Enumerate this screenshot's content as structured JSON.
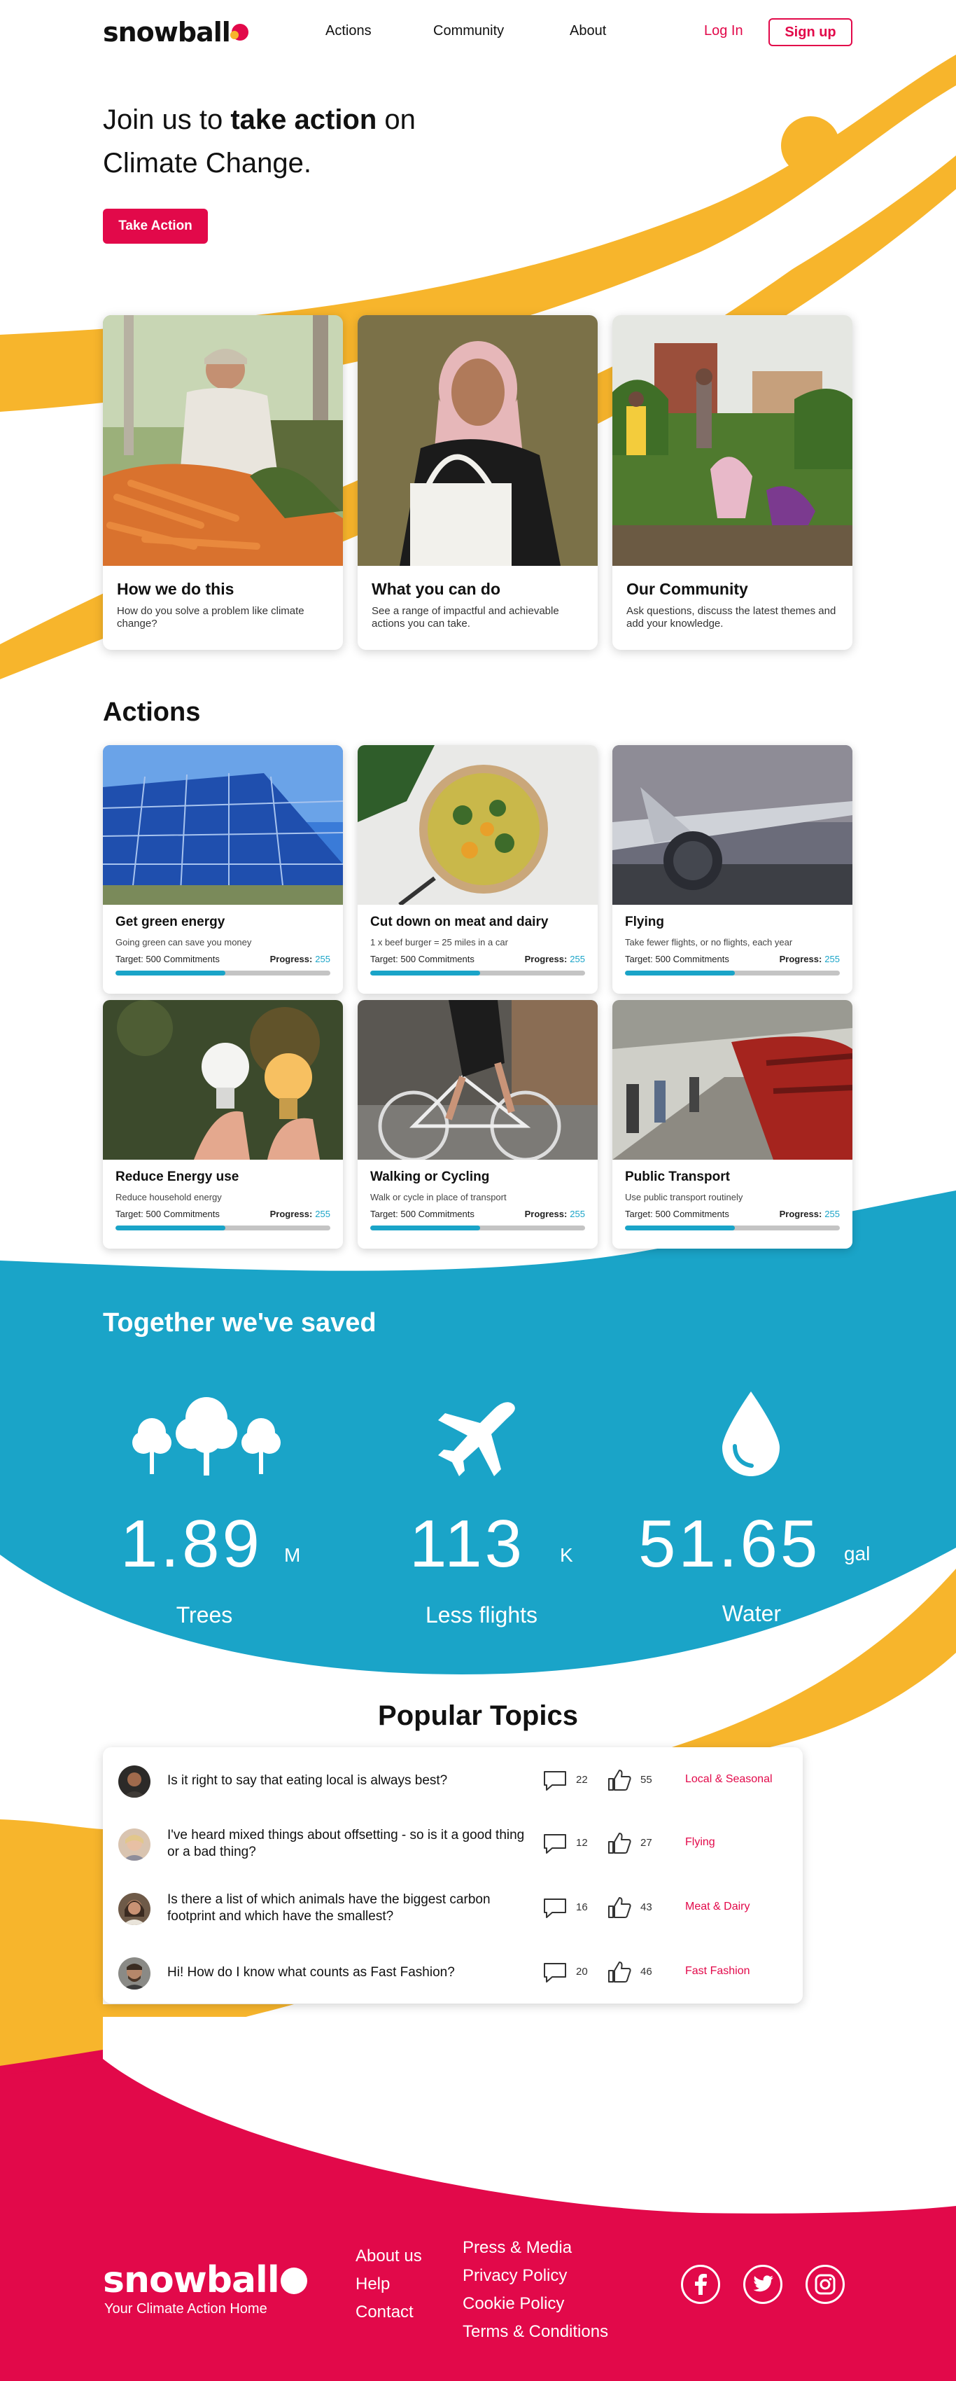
{
  "brand": {
    "name": "snowball",
    "tagline": "Your Climate Action Home",
    "primary_color": "#e2094a",
    "accent_yellow": "#f7b52c",
    "accent_blue": "#1aa4c8"
  },
  "header": {
    "nav": [
      "Actions",
      "Community",
      "About"
    ],
    "login_label": "Log In",
    "signup_label": "Sign up"
  },
  "hero": {
    "title_prefix": "Join us to ",
    "title_bold": "take action",
    "title_suffix": " on",
    "title_line2": "Climate Change.",
    "cta_label": "Take Action"
  },
  "features": [
    {
      "title": "How we do this",
      "description": "How do you solve a problem like climate change?",
      "image": "farmer-carrots-photo"
    },
    {
      "title": "What you can do",
      "description": "See a range of impactful and achievable actions you can take.",
      "image": "woman-tote-bag-photo"
    },
    {
      "title": "Our Community",
      "description": "Ask questions, discuss the latest themes and add your knowledge.",
      "image": "community-garden-photo"
    }
  ],
  "actions": {
    "heading": "Actions",
    "target_label": "Target:",
    "progress_label": "Progress:",
    "items": [
      {
        "title": "Get green energy",
        "description": "Going green can save you money",
        "target": "500 Commitments",
        "progress": "255",
        "progress_fraction": 0.51,
        "image": "solar-panels-photo"
      },
      {
        "title": "Cut down on meat and dairy",
        "description": "1 x beef burger = 25 miles in a car",
        "target": "500 Commitments",
        "progress": "255",
        "progress_fraction": 0.51,
        "image": "salad-bowl-photo"
      },
      {
        "title": "Flying",
        "description": "Take fewer flights, or no flights, each year",
        "target": "500 Commitments",
        "progress": "255",
        "progress_fraction": 0.51,
        "image": "airplane-photo"
      },
      {
        "title": "Reduce Energy use",
        "description": "Reduce household energy",
        "target": "500 Commitments",
        "progress": "255",
        "progress_fraction": 0.51,
        "image": "light-bulbs-photo"
      },
      {
        "title": "Walking or Cycling",
        "description": "Walk or cycle in place of transport",
        "target": "500 Commitments",
        "progress": "255",
        "progress_fraction": 0.51,
        "image": "cyclist-photo"
      },
      {
        "title": "Public Transport",
        "description": "Use public transport routinely",
        "target": "500 Commitments",
        "progress": "255",
        "progress_fraction": 0.51,
        "image": "train-station-photo"
      }
    ]
  },
  "saved": {
    "heading": "Together we've saved",
    "stats": [
      {
        "icon": "trees-icon",
        "value": "1.89",
        "unit": "M",
        "label": "Trees"
      },
      {
        "icon": "airplane-icon",
        "value": "113",
        "unit": "K",
        "label": "Less flights"
      },
      {
        "icon": "water-drop-icon",
        "value": "51.65",
        "unit": "gal",
        "label": "Water"
      }
    ]
  },
  "topics": {
    "heading": "Popular Topics",
    "items": [
      {
        "question": "Is it right to say that eating local is always best?",
        "comments": "22",
        "likes": "55",
        "tag": "Local & Seasonal"
      },
      {
        "question": "I've heard mixed things about offsetting - so is it a good thing or a bad thing?",
        "comments": "12",
        "likes": "27",
        "tag": "Flying"
      },
      {
        "question": "Is there a list of which animals have the biggest carbon footprint and which have the smallest?",
        "comments": "16",
        "likes": "43",
        "tag": "Meat & Dairy"
      },
      {
        "question": "Hi! How do I know what counts as Fast Fashion?",
        "comments": "20",
        "likes": "46",
        "tag": "Fast Fashion"
      }
    ]
  },
  "footer": {
    "col1": [
      "About us",
      "Help",
      "Contact"
    ],
    "col2": [
      "Press & Media",
      "Privacy Policy",
      "Cookie Policy",
      "Terms & Conditions"
    ],
    "social": [
      "facebook-icon",
      "twitter-icon",
      "instagram-icon"
    ]
  }
}
